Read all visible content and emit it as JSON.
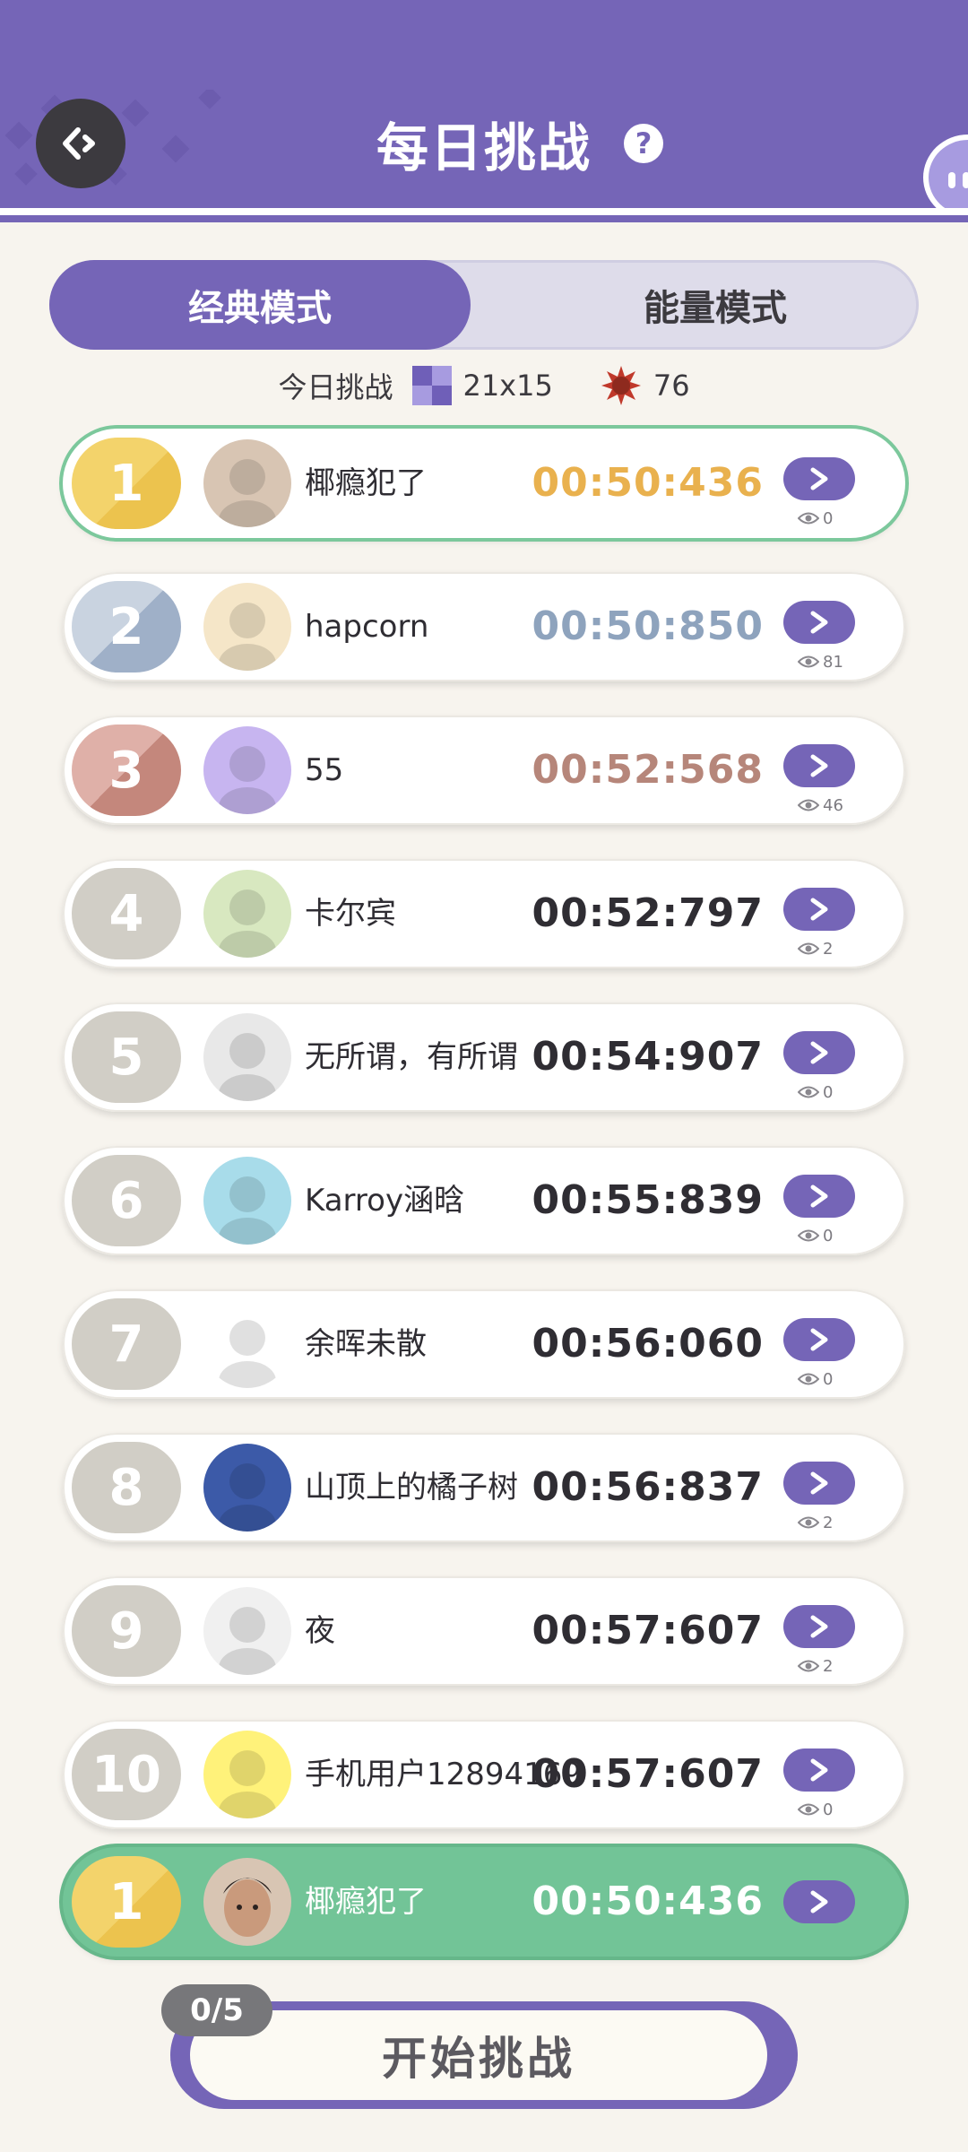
{
  "header": {
    "title": "每日挑战",
    "help": "?",
    "back_icon": "back-arrow-icon"
  },
  "tabs": [
    {
      "label": "经典模式",
      "active": true
    },
    {
      "label": "能量模式",
      "active": false
    }
  ],
  "info": {
    "label": "今日挑战",
    "board_size": "21x15",
    "mines": "76"
  },
  "rows": [
    {
      "rank": "1",
      "name": "椰瘾犯了",
      "time": "00:50:436",
      "views": "0",
      "tier": "gold"
    },
    {
      "rank": "2",
      "name": "hapcorn",
      "time": "00:50:850",
      "views": "81",
      "tier": "silver"
    },
    {
      "rank": "3",
      "name": "55",
      "time": "00:52:568",
      "views": "46",
      "tier": "bronze"
    },
    {
      "rank": "4",
      "name": "卡尔宾",
      "time": "00:52:797",
      "views": "2",
      "tier": "normal"
    },
    {
      "rank": "5",
      "name": "无所谓，有所谓",
      "time": "00:54:907",
      "views": "0",
      "tier": "normal"
    },
    {
      "rank": "6",
      "name": "Karroy涵晗",
      "time": "00:55:839",
      "views": "0",
      "tier": "normal"
    },
    {
      "rank": "7",
      "name": "余晖未散",
      "time": "00:56:060",
      "views": "0",
      "tier": "normal"
    },
    {
      "rank": "8",
      "name": "山顶上的橘子树",
      "time": "00:56:837",
      "views": "2",
      "tier": "normal"
    },
    {
      "rank": "9",
      "name": "夜",
      "time": "00:57:607",
      "views": "2",
      "tier": "normal"
    },
    {
      "rank": "10",
      "name": "手机用户12894169",
      "time": "00:57:607",
      "views": "0",
      "tier": "normal"
    }
  ],
  "me": {
    "rank": "1",
    "name": "椰瘾犯了",
    "time": "00:50:436"
  },
  "start": {
    "label": "开始挑战",
    "counter": "0/5"
  },
  "colors": {
    "primary": "#7565b7",
    "gold": "#e9b14e",
    "silver": "#8ea3bd",
    "bronze": "#b6867a",
    "me_bg": "#72c497"
  }
}
